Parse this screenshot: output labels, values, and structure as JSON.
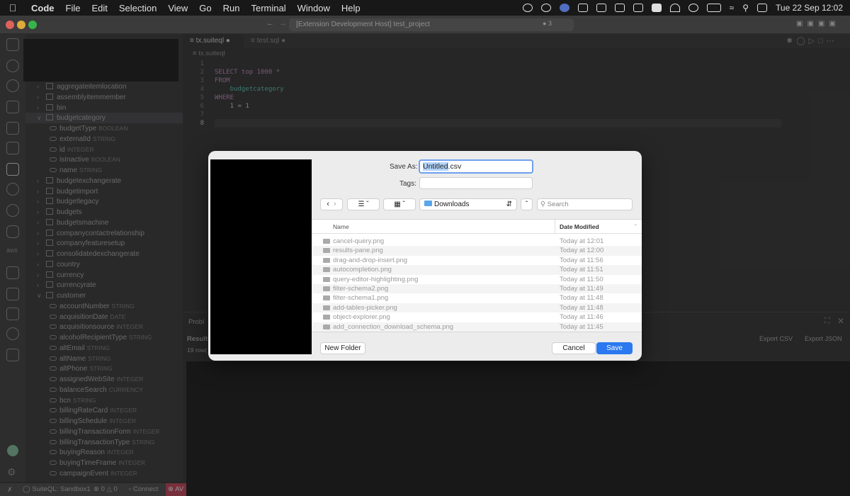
{
  "menubar": {
    "app": "Code",
    "items": [
      "File",
      "Edit",
      "Selection",
      "View",
      "Go",
      "Run",
      "Terminal",
      "Window",
      "Help"
    ],
    "datetime": "Tue 22 Sep  12:02"
  },
  "window": {
    "title": "[Extension Development Host] test_project",
    "badge": "3"
  },
  "tabs": [
    {
      "label": "tx.suiteql",
      "active": true
    },
    {
      "label": "test.sql",
      "active": false
    }
  ],
  "breadcrumb": "tx.suiteql",
  "editor": {
    "line_numbers": [
      "1",
      "2",
      "3",
      "4",
      "5",
      "6",
      "7",
      "8"
    ],
    "lines": [
      "",
      "SELECT top 1000 *",
      "FROM",
      "    budgetcategory",
      "WHERE",
      "    1 = 1",
      "",
      ""
    ]
  },
  "sidebar": {
    "items": [
      {
        "label": "aggregateitemlocation",
        "kind": "table",
        "type": ""
      },
      {
        "label": "assemblyitemmember",
        "kind": "table",
        "type": ""
      },
      {
        "label": "bin",
        "kind": "table",
        "type": ""
      },
      {
        "label": "budgetcategory",
        "kind": "table-open",
        "type": ""
      },
      {
        "label": "budgetType",
        "kind": "field",
        "type": "BOOLEAN"
      },
      {
        "label": "externalId",
        "kind": "field",
        "type": "STRING"
      },
      {
        "label": "id",
        "kind": "field",
        "type": "INTEGER"
      },
      {
        "label": "isInactive",
        "kind": "field",
        "type": "BOOLEAN"
      },
      {
        "label": "name",
        "kind": "field",
        "type": "STRING"
      },
      {
        "label": "budgetexchangerate",
        "kind": "table",
        "type": ""
      },
      {
        "label": "budgetimport",
        "kind": "table",
        "type": ""
      },
      {
        "label": "budgetlegacy",
        "kind": "table",
        "type": ""
      },
      {
        "label": "budgets",
        "kind": "table",
        "type": ""
      },
      {
        "label": "budgetsmachine",
        "kind": "table",
        "type": ""
      },
      {
        "label": "companycontactrelationship",
        "kind": "table",
        "type": ""
      },
      {
        "label": "companyfeaturesetup",
        "kind": "table",
        "type": ""
      },
      {
        "label": "consolidatedexchangerate",
        "kind": "table",
        "type": ""
      },
      {
        "label": "country",
        "kind": "table",
        "type": ""
      },
      {
        "label": "currency",
        "kind": "table",
        "type": ""
      },
      {
        "label": "currencyrate",
        "kind": "table",
        "type": ""
      },
      {
        "label": "customer",
        "kind": "table-open",
        "type": ""
      },
      {
        "label": "accountNumber",
        "kind": "field",
        "type": "STRING"
      },
      {
        "label": "acquisitionDate",
        "kind": "field",
        "type": "DATE"
      },
      {
        "label": "acquisitionsource",
        "kind": "field",
        "type": "INTEGER"
      },
      {
        "label": "alcoholRecipientType",
        "kind": "field",
        "type": "STRING"
      },
      {
        "label": "altEmail",
        "kind": "field",
        "type": "STRING"
      },
      {
        "label": "altName",
        "kind": "field",
        "type": "STRING"
      },
      {
        "label": "altPhone",
        "kind": "field",
        "type": "STRING"
      },
      {
        "label": "assignedWebSite",
        "kind": "field",
        "type": "INTEGER"
      },
      {
        "label": "balanceSearch",
        "kind": "field",
        "type": "CURRENCY"
      },
      {
        "label": "bcn",
        "kind": "field",
        "type": "STRING"
      },
      {
        "label": "billingRateCard",
        "kind": "field",
        "type": "INTEGER"
      },
      {
        "label": "billingSchedule",
        "kind": "field",
        "type": "INTEGER"
      },
      {
        "label": "billingTransactionForm",
        "kind": "field",
        "type": "INTEGER"
      },
      {
        "label": "billingTransactionType",
        "kind": "field",
        "type": "STRING"
      },
      {
        "label": "buyingReason",
        "kind": "field",
        "type": "INTEGER"
      },
      {
        "label": "buyingTimeFrame",
        "kind": "field",
        "type": "INTEGER"
      },
      {
        "label": "campaignEvent",
        "kind": "field",
        "type": "INTEGER"
      }
    ]
  },
  "panel": {
    "tab_problems": "Probl",
    "results_label": "Results",
    "rows_label": "19 row(",
    "export_csv": "Export CSV",
    "export_json": "Export JSON"
  },
  "statusbar": {
    "connection": "SuiteQL: Sandbox1",
    "errors": "0",
    "warnings": "0",
    "connect": "Connect",
    "err_badge": "AV"
  },
  "dialog": {
    "save_as_label": "Save As:",
    "filename_selected": "Untitled",
    "filename_ext": ".csv",
    "tags_label": "Tags:",
    "location": "Downloads",
    "search_placeholder": "Search",
    "col_name": "Name",
    "col_date": "Date Modified",
    "files": [
      {
        "name": "cancel-query.png",
        "date": "Today at 12:01"
      },
      {
        "name": "results-pane.png",
        "date": "Today at 12:00"
      },
      {
        "name": "drag-and-drop-insert.png",
        "date": "Today at 11:56"
      },
      {
        "name": "autocompletion.png",
        "date": "Today at 11:51"
      },
      {
        "name": "query-editor-highlighting.png",
        "date": "Today at 11:50"
      },
      {
        "name": "filter-schema2.png",
        "date": "Today at 11:49"
      },
      {
        "name": "filter-schema1.png",
        "date": "Today at 11:48"
      },
      {
        "name": "add-tables-picker.png",
        "date": "Today at 11:48"
      },
      {
        "name": "object-explorer.png",
        "date": "Today at 11:46"
      },
      {
        "name": "add_connection_download_schema.png",
        "date": "Today at 11:45"
      }
    ],
    "new_folder": "New Folder",
    "cancel": "Cancel",
    "save": "Save"
  }
}
